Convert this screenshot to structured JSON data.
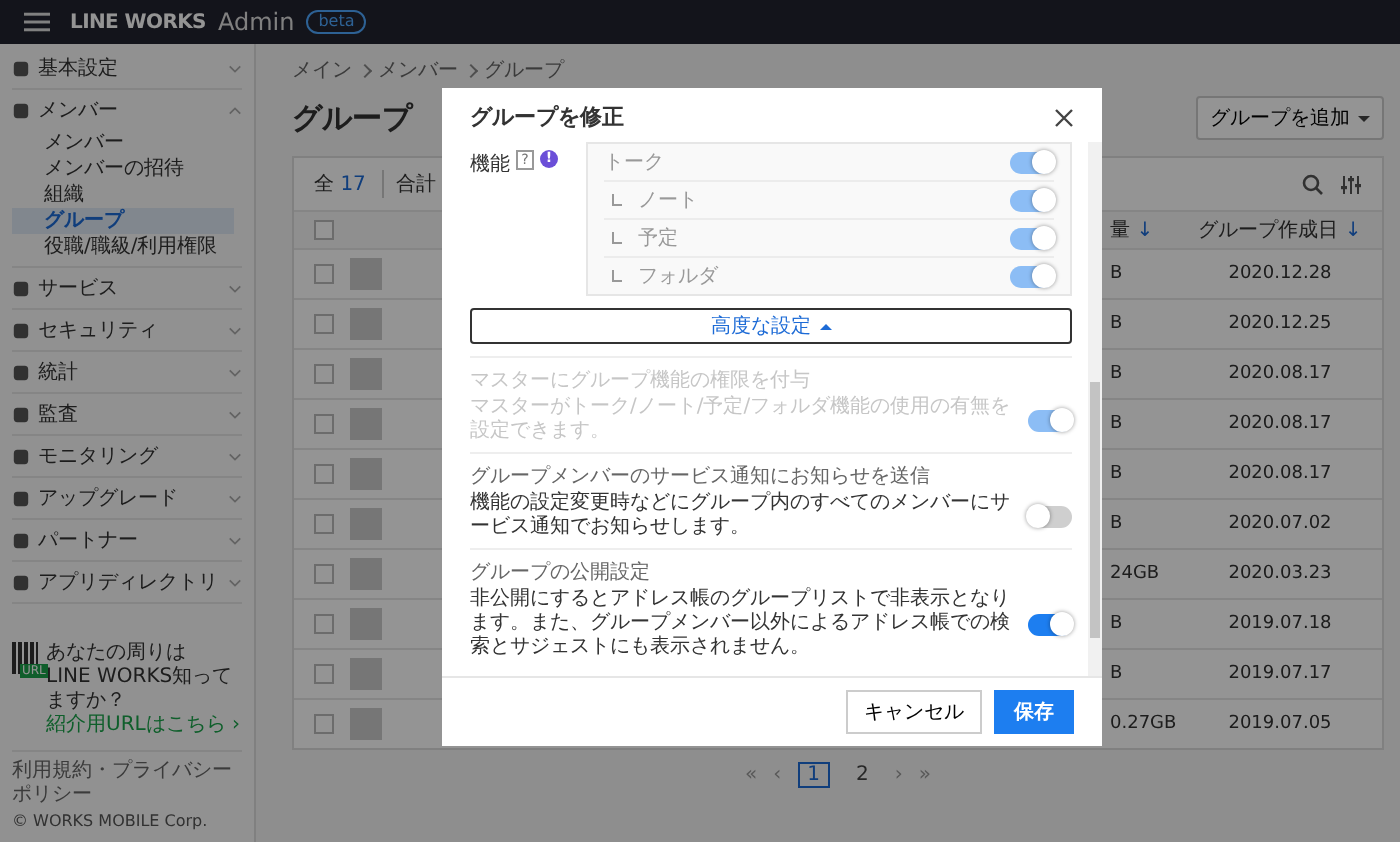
{
  "header": {
    "app_name": "LINE WORKS",
    "suffix": "Admin",
    "badge": "beta"
  },
  "sidebar": {
    "items": [
      {
        "label": "基本設定",
        "expanded": false
      },
      {
        "label": "メンバー",
        "expanded": true,
        "children": [
          {
            "label": "メンバー",
            "selected": false
          },
          {
            "label": "メンバーの招待",
            "selected": false
          },
          {
            "label": "組織",
            "selected": false
          },
          {
            "label": "グループ",
            "selected": true
          },
          {
            "label": "役職/職級/利用権限",
            "selected": false
          }
        ]
      },
      {
        "label": "サービス",
        "expanded": false
      },
      {
        "label": "セキュリティ",
        "expanded": false
      },
      {
        "label": "統計",
        "expanded": false
      },
      {
        "label": "監査",
        "expanded": false
      },
      {
        "label": "モニタリング",
        "expanded": false
      },
      {
        "label": "アップグレード",
        "expanded": false
      },
      {
        "label": "パートナー",
        "expanded": false
      },
      {
        "label": "アプリディレクトリ",
        "expanded": false
      }
    ],
    "promo": {
      "badge": "URL",
      "line_1": "あなたの周りは",
      "line_2": "LINE WORKS知ってますか？",
      "link": "紹介用URLはこちら ›"
    },
    "footer_links": "利用規約・プライバシーポリシー",
    "copyright": "© WORKS MOBILE Corp."
  },
  "breadcrumb": [
    "メイン",
    "メンバー",
    "グループ"
  ],
  "page_title": "グループ",
  "add_button": "グループを追加",
  "table": {
    "total_label": "全",
    "total": "17",
    "sum_label": "合計",
    "all_checked": false,
    "columns": [
      {
        "label": "量",
        "sort": "↓"
      },
      {
        "label": "グループ作成日",
        "sort": "↓"
      }
    ],
    "rows": [
      {
        "checked": false,
        "capacity": "B",
        "created": "2020.12.28"
      },
      {
        "checked": false,
        "capacity": "B",
        "created": "2020.12.25"
      },
      {
        "checked": false,
        "capacity": "B",
        "created": "2020.08.17"
      },
      {
        "checked": false,
        "capacity": "B",
        "created": "2020.08.17"
      },
      {
        "checked": false,
        "capacity": "B",
        "created": "2020.08.17"
      },
      {
        "checked": false,
        "capacity": "B",
        "created": "2020.07.02"
      },
      {
        "checked": false,
        "capacity": "24GB",
        "created": "2020.03.23"
      },
      {
        "checked": false,
        "capacity": "B",
        "created": "2019.07.18"
      },
      {
        "checked": false,
        "capacity": "B",
        "created": "2019.07.17"
      },
      {
        "checked": false,
        "capacity": "0.27GB",
        "created": "2019.07.05"
      }
    ]
  },
  "pagination": {
    "first": "«",
    "previous": "‹",
    "pages": [
      {
        "label": "1",
        "selected": true
      },
      {
        "label": "2",
        "selected": false
      }
    ],
    "next": "›",
    "last": "»"
  },
  "dialog": {
    "title": "グループを修正",
    "features_label": "機能",
    "help_mark": "?",
    "info_mark": "!",
    "features": [
      {
        "label": "トーク",
        "on": true,
        "disabled": true,
        "children": [
          {
            "label": "ノート",
            "on": true,
            "disabled": true
          },
          {
            "label": "予定",
            "on": true,
            "disabled": true
          },
          {
            "label": "フォルダ",
            "on": true,
            "disabled": true
          }
        ]
      }
    ],
    "advanced_button": "高度な設定",
    "settings": [
      {
        "title": "マスターにグループ機能の権限を付与",
        "description": "マスターがトーク/ノート/予定/フォルダ機能の使用の有無を設定できます。",
        "on": true,
        "disabled": true
      },
      {
        "title": "グループメンバーのサービス通知にお知らせを送信",
        "description": "機能の設定変更時などにグループ内のすべてのメンバーにサービス通知でお知らせします。",
        "on": false,
        "disabled": false
      },
      {
        "title": "グループの公開設定",
        "description": "非公開にするとアドレス帳のグループリストで非表示となります。また、グループメンバー以外によるアドレス帳での検索とサジェストにも表示されません。",
        "on": true,
        "disabled": false
      }
    ],
    "cancel_button": "キャンセル",
    "save_button": "保存"
  }
}
